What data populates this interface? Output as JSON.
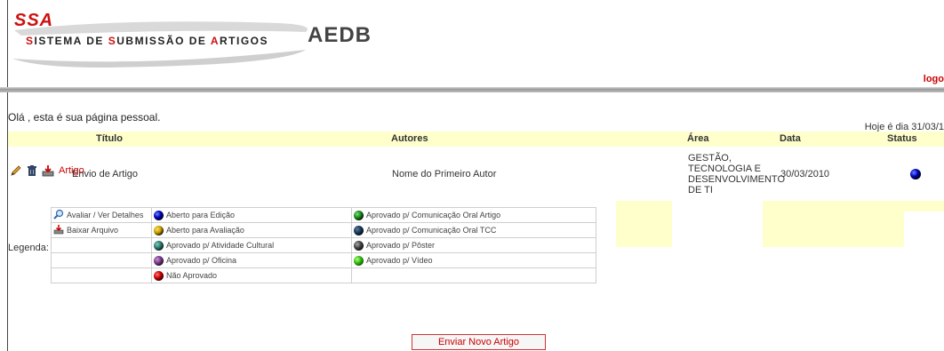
{
  "header": {
    "ssa": "SSA",
    "system_name_parts": [
      "S",
      "ISTEMA DE ",
      "S",
      "UBMISSÃO DE ",
      "A",
      "RTIGOS"
    ],
    "aedb": "AEDB",
    "logout": "logo"
  },
  "greeting": "Olá  , esta é sua página pessoal.",
  "today": "Hoje é dia 31/03/1",
  "table": {
    "headers": {
      "titulo": "Título",
      "autores": "Autores",
      "area": "Área",
      "data": "Data",
      "status": "Status"
    },
    "row": {
      "artigo_link": "Artigo",
      "titulo": "Envio de Artigo",
      "autores": "Nome do Primeiro Autor",
      "area": [
        "GESTÃO,",
        "TECNOLOGIA E",
        "DESENVOLVIMENTO",
        "DE TI"
      ],
      "data": "30/03/2010",
      "status_icon": "blue-ball-icon"
    }
  },
  "legend": {
    "label": "Legenda:",
    "actions": [
      {
        "icon": "magnifier-icon",
        "text": "Avaliar / Ver Detalhes"
      },
      {
        "icon": "download-icon",
        "text": "Baixar Arquivo"
      }
    ],
    "status_col1": [
      {
        "color": "#0000bb",
        "text": "Aberto para Edição"
      },
      {
        "color": "#c8a000",
        "text": "Aberto para Avaliação"
      },
      {
        "color": "#2e7a6e",
        "text": "Aprovado p/ Atividade Cultural"
      },
      {
        "color": "#7a3a8a",
        "text": "Aprovado p/ Oficina"
      },
      {
        "color": "#cc0000",
        "text": "Não Aprovado"
      }
    ],
    "status_col2": [
      {
        "color": "#1a8a1a",
        "text": "Aprovado p/ Comunicação Oral Artigo"
      },
      {
        "color": "#1a3a5a",
        "text": "Aprovado p/ Comunicação Oral TCC"
      },
      {
        "color": "#444444",
        "text": "Aprovado p/ Pôster"
      },
      {
        "color": "#33bb11",
        "text": "Aprovado p/ Vídeo"
      }
    ]
  },
  "button": {
    "label": "Enviar Novo Artigo"
  }
}
